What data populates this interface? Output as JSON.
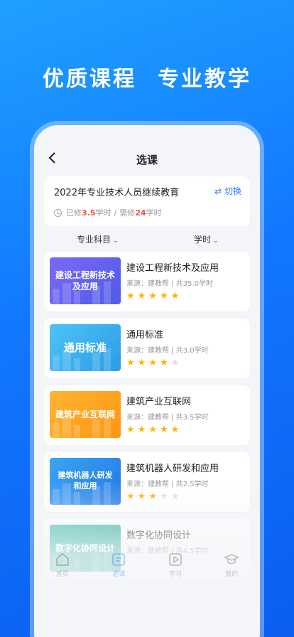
{
  "headline": {
    "left": "优质课程",
    "right": "专业教学"
  },
  "nav": {
    "title": "选课",
    "back_icon": "chevron-left-icon"
  },
  "program": {
    "name": "2022年专业技术人员继续教育",
    "switch_label": "切换",
    "done_prefix": "已修",
    "done_value": "3.5",
    "done_unit": "学时",
    "separator": "/",
    "need_prefix": "需修",
    "need_value": "24",
    "need_unit": "学时"
  },
  "filters": {
    "major": "专业科目",
    "hours": "学时"
  },
  "courses": [
    {
      "title": "建设工程新技术及应用",
      "thumb_line1": "建设工程新技术",
      "thumb_line2": "及应用",
      "meta": "来源：建教帮 | 共35.0学时",
      "rating": 5
    },
    {
      "title": "通用标准",
      "thumb_line1": "通用标准",
      "thumb_line2": "",
      "meta": "来源：建教帮 | 共3.0学时",
      "rating": 4
    },
    {
      "title": "建筑产业互联网",
      "thumb_line1": "建筑产业互联网",
      "thumb_line2": "",
      "meta": "来源：建教帮 | 共3.5学时",
      "rating": 5
    },
    {
      "title": "建筑机器人研发和应用",
      "thumb_line1": "建筑机器人研发",
      "thumb_line2": "和应用",
      "meta": "来源：建教帮 | 共2.5学时",
      "rating": 3
    },
    {
      "title": "数字化协同设计",
      "thumb_line1": "数字化协同设计",
      "thumb_line2": "",
      "meta": "来源：建教帮 | 共4.5学时",
      "rating": 0
    }
  ],
  "tabs": [
    {
      "label": "首页",
      "icon": "home-icon"
    },
    {
      "label": "选课",
      "icon": "course-list-icon"
    },
    {
      "label": "学习",
      "icon": "play-icon"
    },
    {
      "label": "我的",
      "icon": "graduation-cap-icon"
    }
  ],
  "colors": {
    "accent": "#2f7bff",
    "highlight_red": "#ff4a3d",
    "star": "#ffb400",
    "thumb_purple": "#6a5cf0",
    "thumb_sky": "#3ab0f2",
    "thumb_orange": "#ffa41c",
    "thumb_blue": "#2d8ef0",
    "thumb_teal": "#35b7a8"
  }
}
